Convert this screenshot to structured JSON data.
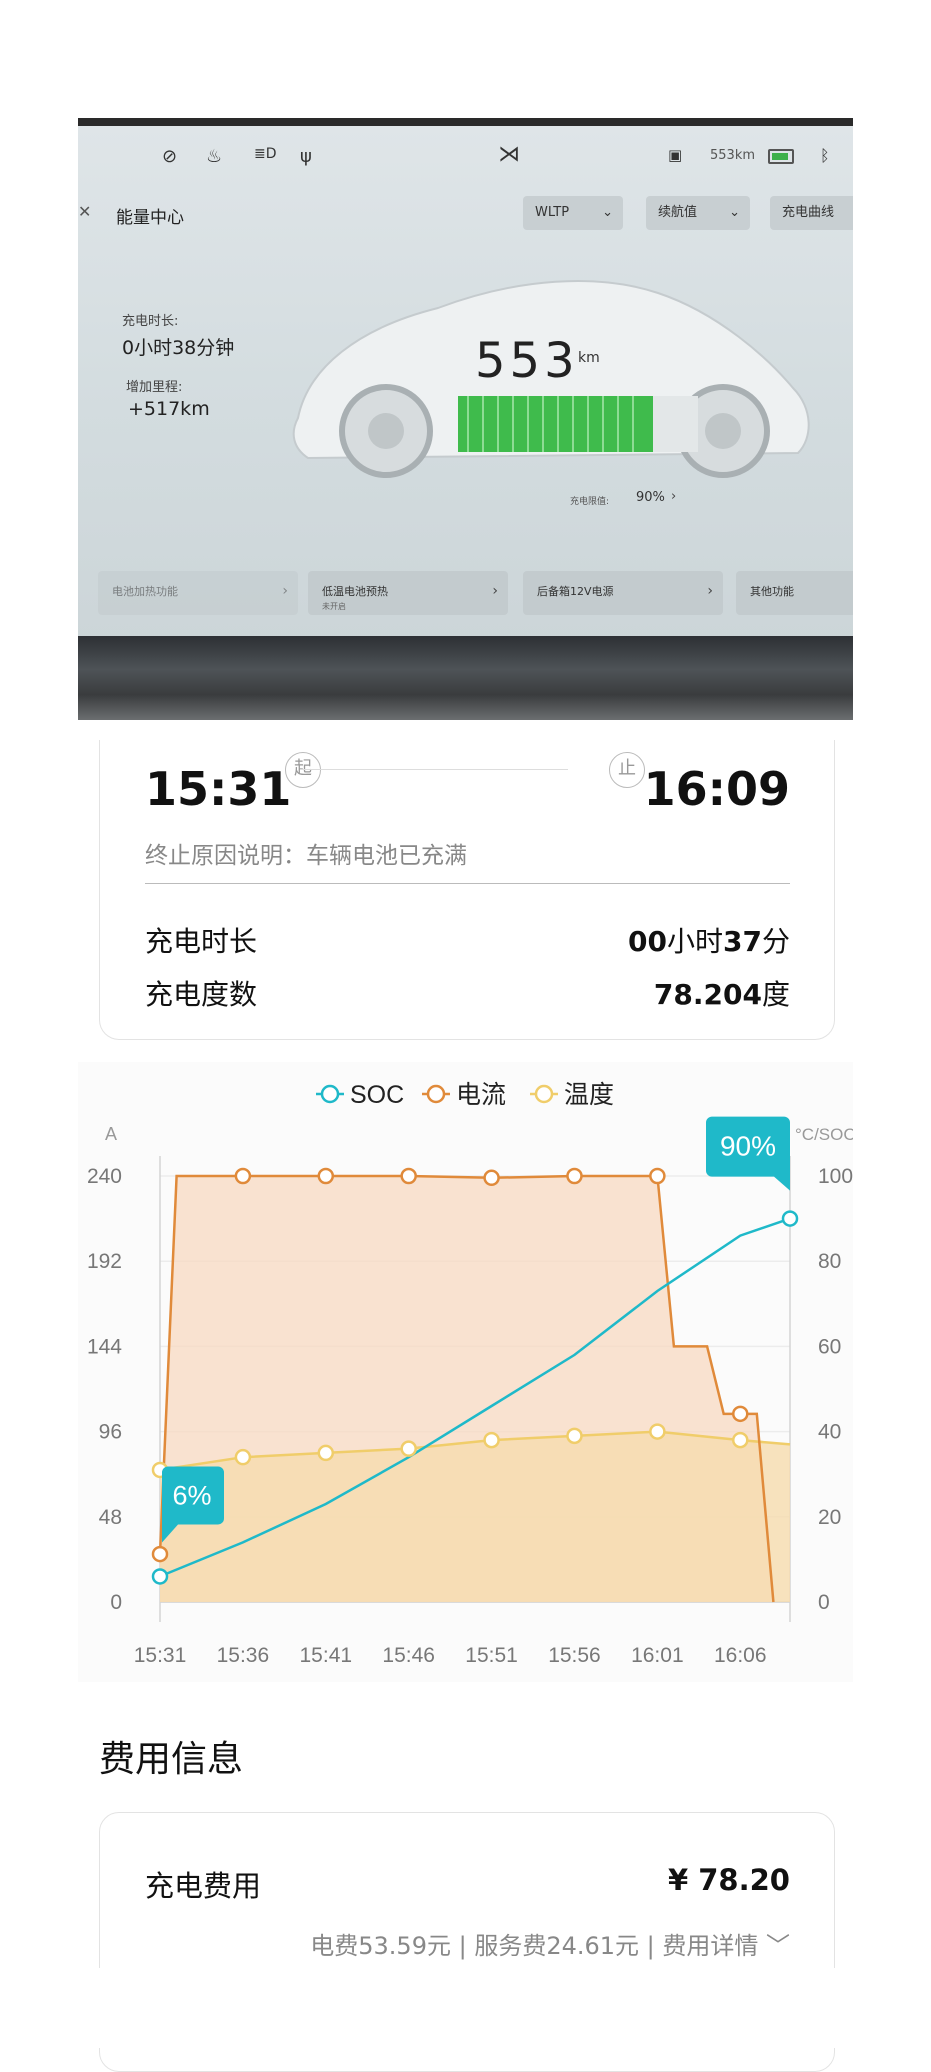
{
  "car_screen": {
    "status_icons": [
      "steering-icon",
      "defrost-icon",
      "headlight-auto-icon",
      "usb-icon"
    ],
    "brand_logo": "xpeng-logo",
    "range_status": "553km",
    "title": "能量中心",
    "mode_dropdown": "WLTP",
    "range_dropdown": "续航值",
    "charge_curve_btn": "充电曲线",
    "charge_duration_label": "充电时长:",
    "charge_duration_value": "0小时38分钟",
    "added_range_label": "增加里程:",
    "added_range_value": "+517km",
    "range_value": "553",
    "range_unit": "km",
    "charge_limit_label": "充电限值:",
    "charge_limit_value": "90%",
    "bottom_cards": [
      {
        "label": "电池加热功能",
        "sub": ""
      },
      {
        "label": "低温电池预热",
        "sub": "未开启"
      },
      {
        "label": "后备箱12V电源",
        "sub": ""
      },
      {
        "label": "其他功能",
        "sub": ""
      }
    ]
  },
  "session": {
    "start_time": "15:31",
    "start_tag": "起",
    "end_tag": "止",
    "end_time": "16:09",
    "reason": "终止原因说明：车辆电池已充满",
    "duration_label": "充电时长",
    "duration_hours": "00",
    "duration_hours_unit": "小时",
    "duration_minutes": "37",
    "duration_minutes_unit": "分",
    "energy_label": "充电度数",
    "energy_value": "78.204",
    "energy_unit": "度"
  },
  "chart_data": {
    "type": "line",
    "legend": [
      "SOC",
      "电流",
      "温度"
    ],
    "left_axis_unit": "A",
    "right_axis_unit": "°C/SOC",
    "x_ticks": [
      "15:31",
      "15:36",
      "15:41",
      "15:46",
      "15:51",
      "15:56",
      "16:01",
      "16:06"
    ],
    "x_range": [
      "15:31",
      "16:09"
    ],
    "left_ticks": [
      0,
      48,
      96,
      144,
      192,
      240
    ],
    "right_ticks": [
      0,
      20,
      40,
      60,
      80,
      100
    ],
    "y_left_range": [
      0,
      240
    ],
    "y_right_range": [
      0,
      100
    ],
    "series": [
      {
        "name": "SOC",
        "axis": "right",
        "color": "#1fb9c9",
        "points": [
          [
            "15:31",
            6
          ],
          [
            "15:36",
            14
          ],
          [
            "15:41",
            23
          ],
          [
            "15:46",
            34
          ],
          [
            "15:51",
            46
          ],
          [
            "15:56",
            58
          ],
          [
            "16:01",
            73
          ],
          [
            "16:06",
            86
          ],
          [
            "16:09",
            90
          ]
        ]
      },
      {
        "name": "电流",
        "axis": "left",
        "color": "#e08a3a",
        "points": [
          [
            "15:31",
            27
          ],
          [
            "15:32",
            240
          ],
          [
            "15:36",
            240
          ],
          [
            "15:41",
            240
          ],
          [
            "15:46",
            240
          ],
          [
            "15:51",
            239
          ],
          [
            "15:56",
            240
          ],
          [
            "16:01",
            240
          ],
          [
            "16:02",
            144
          ],
          [
            "16:04",
            144
          ],
          [
            "16:05",
            106
          ],
          [
            "16:07",
            106
          ],
          [
            "16:08",
            0
          ]
        ]
      },
      {
        "name": "温度",
        "axis": "right",
        "color": "#f0cd6a",
        "points": [
          [
            "15:31",
            31
          ],
          [
            "15:36",
            34
          ],
          [
            "15:41",
            35
          ],
          [
            "15:46",
            36
          ],
          [
            "15:51",
            38
          ],
          [
            "15:56",
            39
          ],
          [
            "16:01",
            40
          ],
          [
            "16:06",
            38
          ],
          [
            "16:09",
            37
          ]
        ]
      }
    ],
    "annotations": [
      {
        "text": "6%"
      },
      {
        "text": "90%"
      }
    ]
  },
  "fees": {
    "section_title": "费用信息",
    "total_label": "充电费用",
    "total_value": "¥ 78.20",
    "detail": "电费53.59元 | 服务费24.61元 | 费用详情 ﹀"
  }
}
